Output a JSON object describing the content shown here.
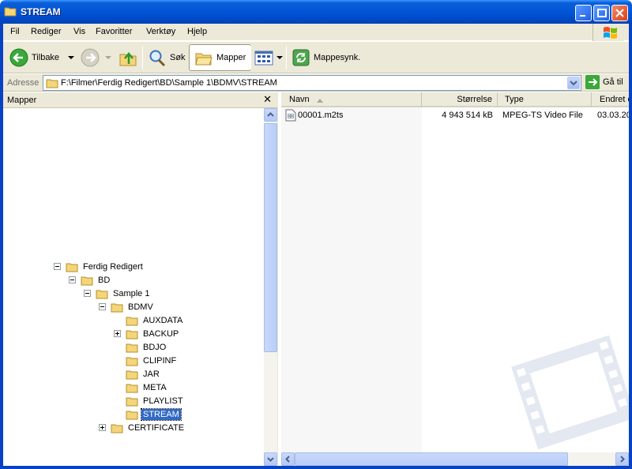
{
  "window": {
    "title": "STREAM"
  },
  "menu": {
    "items": [
      "Fil",
      "Rediger",
      "Vis",
      "Favoritter",
      "Verktøy",
      "Hjelp"
    ]
  },
  "toolbar": {
    "back_label": "Tilbake",
    "search_label": "Søk",
    "folders_label": "Mapper",
    "sync_label": "Mappesynk."
  },
  "address": {
    "label": "Adresse",
    "path": "F:\\Filmer\\Ferdig Redigert\\BD\\Sample 1\\BDMV\\STREAM",
    "go_label": "Gå til"
  },
  "folders_pane": {
    "title": "Mapper",
    "close_glyph": "✕",
    "tree": [
      {
        "name": "Ferdig Redigert",
        "expander": "minus"
      },
      {
        "name": "BD",
        "expander": "minus"
      },
      {
        "name": "Sample 1",
        "expander": "minus"
      },
      {
        "name": "BDMV",
        "expander": "minus"
      },
      {
        "name": "AUXDATA",
        "expander": "none"
      },
      {
        "name": "BACKUP",
        "expander": "plus"
      },
      {
        "name": "BDJO",
        "expander": "none"
      },
      {
        "name": "CLIPINF",
        "expander": "none"
      },
      {
        "name": "JAR",
        "expander": "none"
      },
      {
        "name": "META",
        "expander": "none"
      },
      {
        "name": "PLAYLIST",
        "expander": "none"
      },
      {
        "name": "STREAM",
        "expander": "none",
        "selected": true
      },
      {
        "name": "CERTIFICATE",
        "expander": "plus"
      }
    ]
  },
  "file_list": {
    "columns": [
      "Navn",
      "Størrelse",
      "Type",
      "Endret d"
    ],
    "rows": [
      {
        "name": "00001.m2ts",
        "size": "4 943 514 kB",
        "type": "MPEG-TS Video File",
        "modified": "03.03.20"
      }
    ]
  },
  "colors": {
    "titlebar": "#0255d6",
    "selection": "#316ac5",
    "chrome": "#ece9d8"
  }
}
